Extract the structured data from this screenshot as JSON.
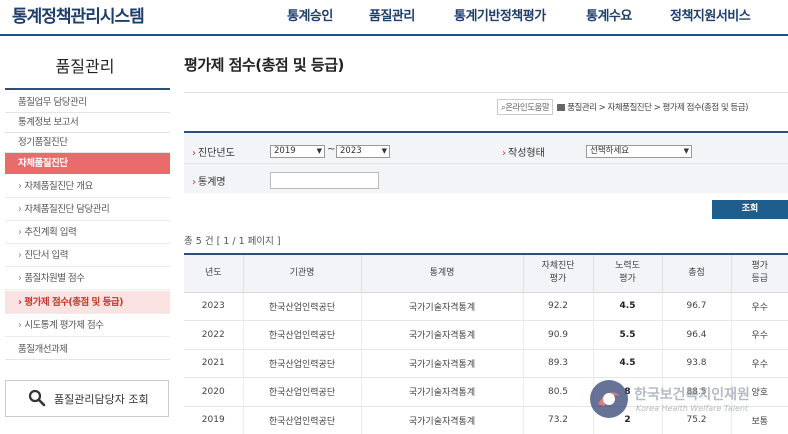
{
  "header": {
    "logo": "통계정책관리시스템",
    "nav": [
      "통계승인",
      "품질관리",
      "통계기반정책평가",
      "통계수요",
      "정책지원서비스"
    ]
  },
  "sidebar": {
    "title": "품질관리",
    "items": [
      {
        "label": "품질업무 담당관리",
        "type": "top"
      },
      {
        "label": "통계정보 보고서",
        "type": "top"
      },
      {
        "label": "정기품질진단",
        "type": "top"
      },
      {
        "label": "자체품질진단",
        "type": "category"
      },
      {
        "label": "자체품질진단 개요",
        "type": "sub"
      },
      {
        "label": "자체품질진단 담당관리",
        "type": "sub"
      },
      {
        "label": "추진계획 입력",
        "type": "sub"
      },
      {
        "label": "진단서 입력",
        "type": "sub"
      },
      {
        "label": "품질차원별 점수",
        "type": "sub"
      },
      {
        "label": "평가제 점수(총점 및 등급)",
        "type": "selected"
      },
      {
        "label": "시도통계 평가제 점수",
        "type": "sub"
      },
      {
        "label": "품질개선과제",
        "type": "top"
      }
    ],
    "search_label": "품질관리담당자 조회"
  },
  "main": {
    "title": "평가제 점수(총점 및 등급)",
    "breadcrumb": {
      "gallery": "온라인도움말",
      "path": "품질관리 > 자체품질진단 > 평가제 점수(총점 및 등급)"
    },
    "filter": {
      "year_label": "진단년도",
      "year_from": "2019",
      "tilde": "~",
      "year_to": "2023",
      "form_label": "작성형태",
      "form_value": "선택하세요",
      "stat_label": "통계명",
      "stat_value": ""
    },
    "query_button": "조회",
    "count": "총 5 건  [ 1 / 1 페이지 ]",
    "table": {
      "headers": [
        "년도",
        "기관명",
        "통계명",
        "자체진단\n평가",
        "노력도\n평가",
        "총점",
        "평가\n등급"
      ],
      "rows": [
        [
          "2023",
          "한국산업인력공단",
          "국가기술자격통계",
          "92.2",
          "4.5",
          "96.7",
          "우수"
        ],
        [
          "2022",
          "한국산업인력공단",
          "국가기술자격통계",
          "90.9",
          "5.5",
          "96.4",
          "우수"
        ],
        [
          "2021",
          "한국산업인력공단",
          "국가기술자격통계",
          "89.3",
          "4.5",
          "93.8",
          "우수"
        ],
        [
          "2020",
          "한국산업인력공단",
          "국가기술자격통계",
          "80.5",
          "8",
          "88.5",
          "양호"
        ],
        [
          "2019",
          "한국산업인력공단",
          "국가기술자격통계",
          "73.2",
          "2",
          "75.2",
          "보통"
        ]
      ]
    }
  },
  "watermark": {
    "korean": "한국보건복지인재원",
    "english": "Korea Health Welfare Talent"
  },
  "colors": {
    "navy": "#1f3f6a",
    "accent_red": "#e96b6b",
    "button_blue": "#1f5d8d"
  }
}
